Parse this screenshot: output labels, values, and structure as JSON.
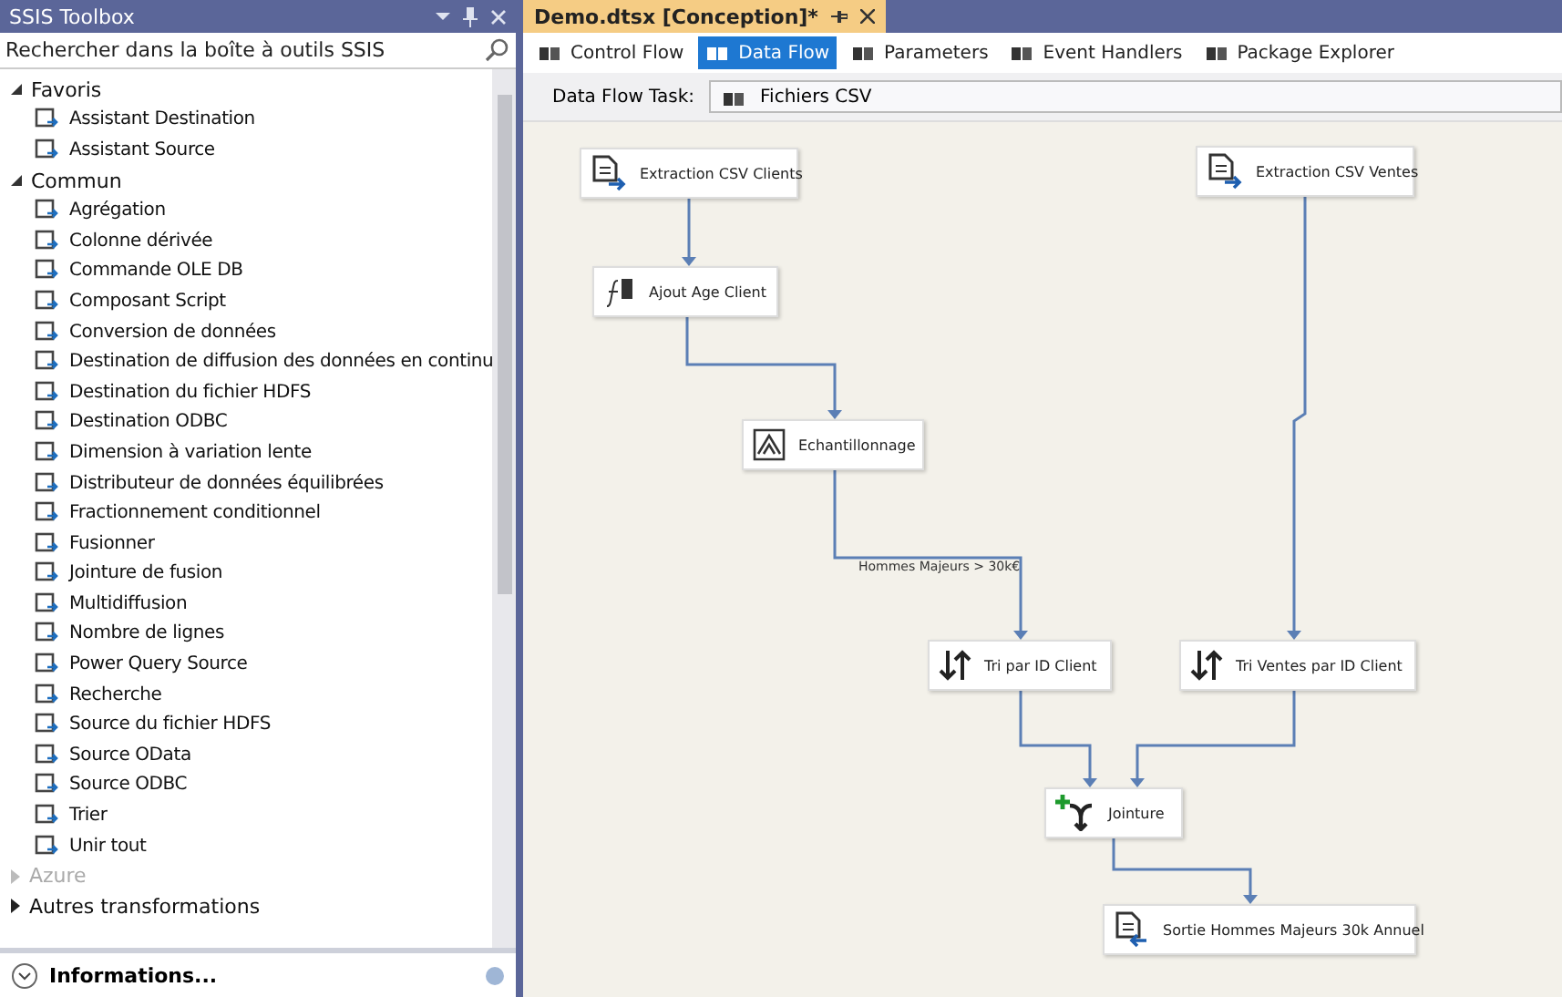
{
  "toolbox": {
    "title": "SSIS Toolbox",
    "search": {
      "placeholder": "Rechercher dans la boîte à outils SSIS"
    },
    "groups": [
      {
        "label": "Favoris",
        "expanded": true,
        "disabled": false,
        "items": [
          "Assistant Destination",
          "Assistant Source"
        ]
      },
      {
        "label": "Commun",
        "expanded": true,
        "disabled": false,
        "items": [
          "Agrégation",
          "Colonne dérivée",
          "Commande OLE DB",
          "Composant Script",
          "Conversion de données",
          "Destination de diffusion des données en continu",
          "Destination du fichier HDFS",
          "Destination ODBC",
          "Dimension à variation lente",
          "Distributeur de données équilibrées",
          "Fractionnement conditionnel",
          "Fusionner",
          "Jointure de fusion",
          "Multidiffusion",
          "Nombre de lignes",
          "Power Query Source",
          "Recherche",
          "Source du fichier HDFS",
          "Source OData",
          "Source ODBC",
          "Trier",
          "Unir tout"
        ]
      },
      {
        "label": "Azure",
        "expanded": false,
        "disabled": true
      },
      {
        "label": "Autres transformations",
        "expanded": false,
        "disabled": false
      }
    ],
    "info_title": "Informations..."
  },
  "document": {
    "tab": "Demo.dtsx [Conception]*",
    "tabs": [
      {
        "label": "Control Flow",
        "selected": false
      },
      {
        "label": "Data Flow",
        "selected": true
      },
      {
        "label": "Parameters",
        "selected": false
      },
      {
        "label": "Event Handlers",
        "selected": false
      },
      {
        "label": "Package Explorer",
        "selected": false
      }
    ],
    "task_label": "Data Flow Task:",
    "task_value": "Fichiers CSV",
    "nodes": [
      {
        "label": "Extraction CSV Clients",
        "kind": "source"
      },
      {
        "label": "Ajout Age Client",
        "kind": "derived"
      },
      {
        "label": "Echantillonnage",
        "kind": "sample"
      },
      {
        "label": "Extraction CSV Ventes",
        "kind": "source"
      },
      {
        "label": "Tri par ID Client",
        "kind": "sort"
      },
      {
        "label": "Tri Ventes par ID Client",
        "kind": "sort"
      },
      {
        "label": "Jointure",
        "kind": "join"
      },
      {
        "label": "Sortie Hommes Majeurs 30k Annuel",
        "kind": "destination"
      }
    ],
    "path_label": "Hommes Majeurs > 30k€"
  }
}
